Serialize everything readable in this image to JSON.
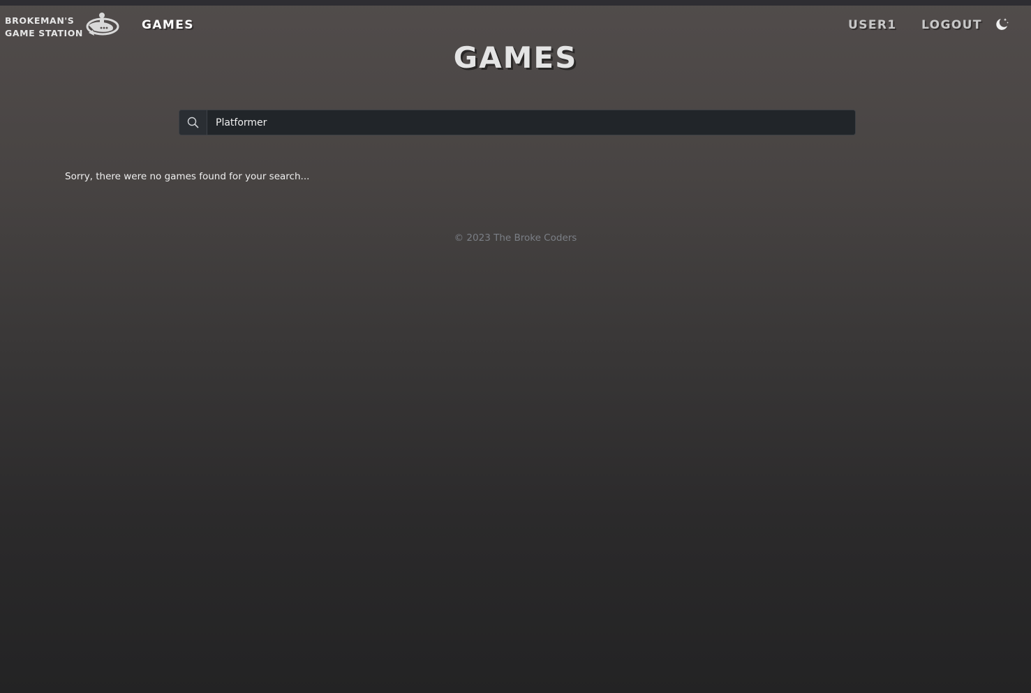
{
  "navbar": {
    "brand_line1": "Brokeman's",
    "brand_line2": "Game Station",
    "brand_logo_icon": "spaceship-icon",
    "games_link": "Games",
    "user_link": "user1",
    "logout_link": "Logout",
    "theme_toggle_icon": "moon-stars-icon"
  },
  "main": {
    "title": "Games",
    "search": {
      "icon": "search-icon",
      "value": "Platformer"
    },
    "empty_message": "Sorry, there were no games found for your search..."
  },
  "footer": {
    "text": "© 2023 The Broke Coders"
  },
  "colors": {
    "search_background": "#212529",
    "footer_text": "#7b7f86",
    "nav_link": "#c8c8c8"
  }
}
